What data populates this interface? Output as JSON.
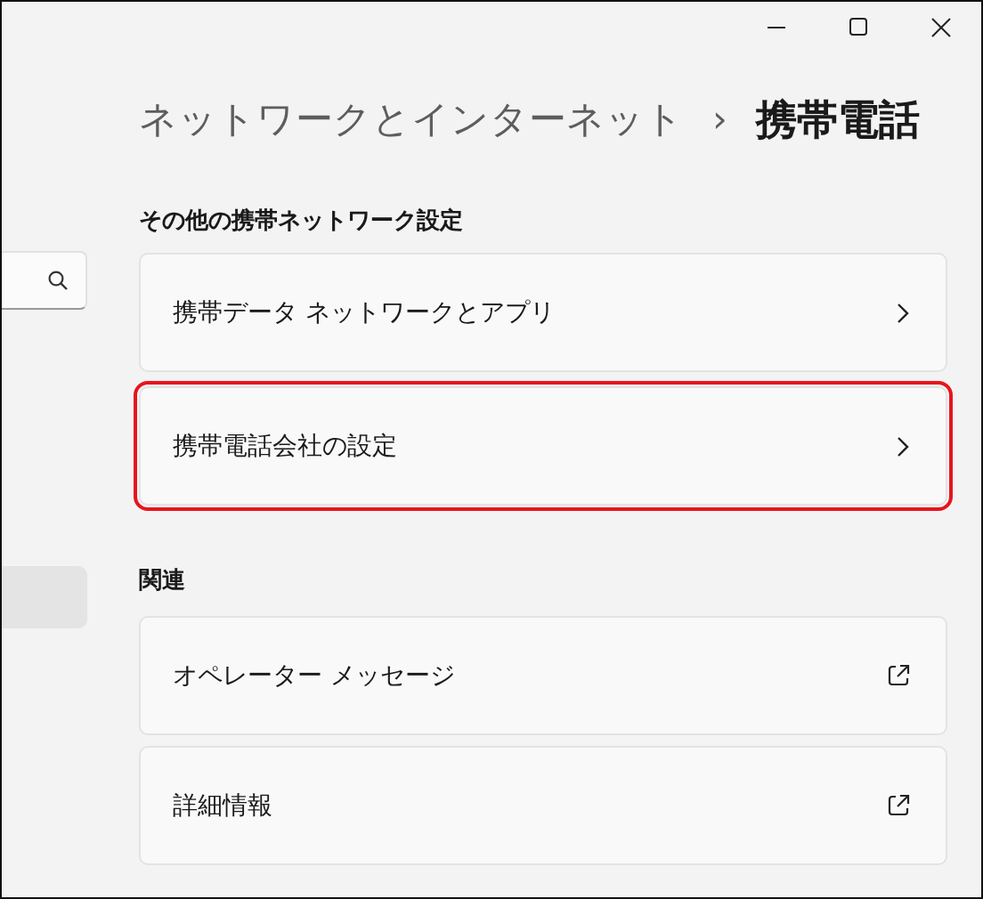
{
  "breadcrumb": {
    "parent": "ネットワークとインターネット",
    "separator": "›",
    "current": "携帯電話"
  },
  "sidebar": {
    "items": [
      {
        "selected": true
      }
    ]
  },
  "sections": [
    {
      "title": "その他の携帯ネットワーク設定",
      "items": [
        {
          "label": "携帯データ ネットワークとアプリ",
          "kind": "nav",
          "highlighted": false
        },
        {
          "label": "携帯電話会社の設定",
          "kind": "nav",
          "highlighted": true
        }
      ]
    },
    {
      "title": "関連",
      "items": [
        {
          "label": "オペレーター メッセージ",
          "kind": "external",
          "highlighted": false
        },
        {
          "label": "詳細情報",
          "kind": "external",
          "highlighted": false
        }
      ]
    }
  ]
}
